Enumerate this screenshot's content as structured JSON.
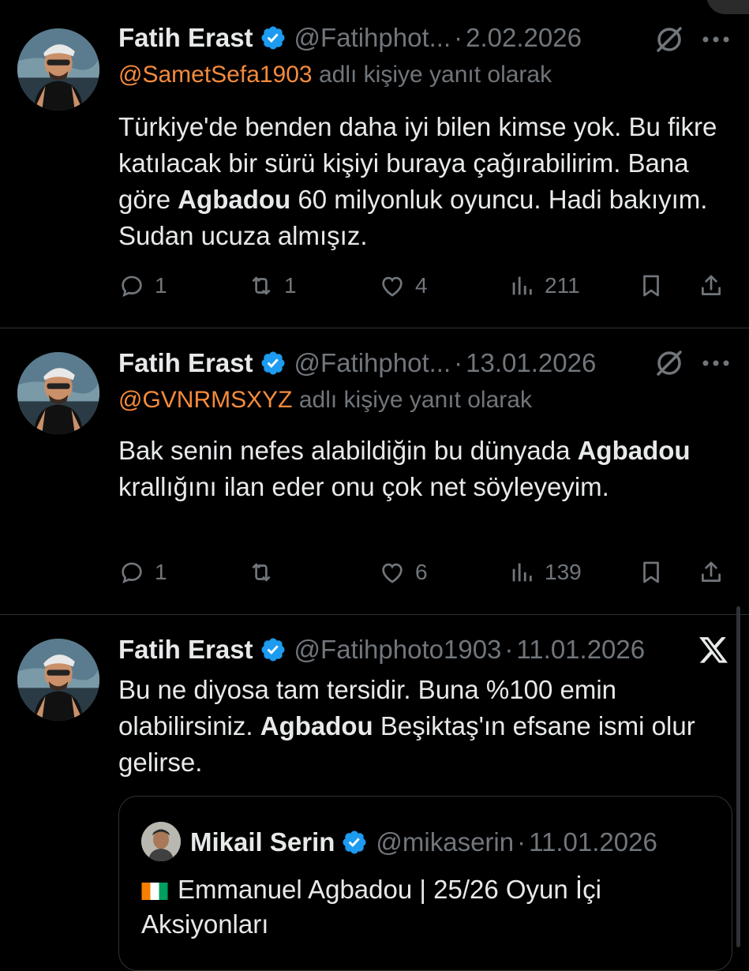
{
  "tweets": [
    {
      "name": "Fatih Erast",
      "handle": "@Fatihphot...",
      "sep": "·",
      "date": "2.02.2026",
      "reply_mention": "@SametSefa1903",
      "reply_suffix": " adlı kişiye yanıt olarak",
      "text_parts": [
        {
          "t": "Türkiye'de benden daha iyi bilen kimse yok. Bu fikre katılacak bir sürü kişiyi buraya çağırabilirim. Bana göre ",
          "b": false
        },
        {
          "t": "Agbadou",
          "b": true
        },
        {
          "t": " 60 milyonluk oyuncu. Hadi bakıyım. Sudan ucuza almışız.",
          "b": false
        }
      ],
      "replies": "1",
      "retweets": "1",
      "likes": "4",
      "views": "211"
    },
    {
      "name": "Fatih Erast",
      "handle": "@Fatihphot...",
      "sep": "·",
      "date": "13.01.2026",
      "reply_mention": "@GVNRMSXYZ",
      "reply_suffix": " adlı kişiye yanıt olarak",
      "text_parts": [
        {
          "t": "Bak senin nefes alabildiğin bu dünyada ",
          "b": false
        },
        {
          "t": "Agbadou",
          "b": true
        },
        {
          "t": " krallığını ilan eder onu çok net söyleyeyim.",
          "b": false
        }
      ],
      "replies": "1",
      "retweets": "",
      "likes": "6",
      "views": "139"
    },
    {
      "name": "Fatih Erast",
      "handle": "@Fatihphoto1903",
      "sep": "·",
      "date": "11.01.2026",
      "text_parts": [
        {
          "t": "Bu ne diyosa tam tersidir. Buna %100 emin olabilirsiniz. ",
          "b": false
        },
        {
          "t": "Agbadou",
          "b": true
        },
        {
          "t": " Beşiktaş'ın efsane ismi olur gelirse.",
          "b": false
        }
      ]
    }
  ],
  "quote": {
    "name": "Mikail Serin",
    "handle": "@mikaserin",
    "sep": "·",
    "date": "11.01.2026",
    "text": "Emmanuel Agbadou | 25/26 Oyun İçi Aksiyonları"
  },
  "colors": {
    "background": "#000000",
    "text": "#e7e9ea",
    "muted": "#71767b",
    "mention": "#f58b3c",
    "verified": "#1d9bf0",
    "divider": "#2f3336"
  },
  "icons": [
    "reply-icon",
    "retweet-icon",
    "like-icon",
    "views-icon",
    "bookmark-icon",
    "share-icon",
    "grok-icon",
    "more-icon",
    "x-logo-icon",
    "verified-icon"
  ]
}
